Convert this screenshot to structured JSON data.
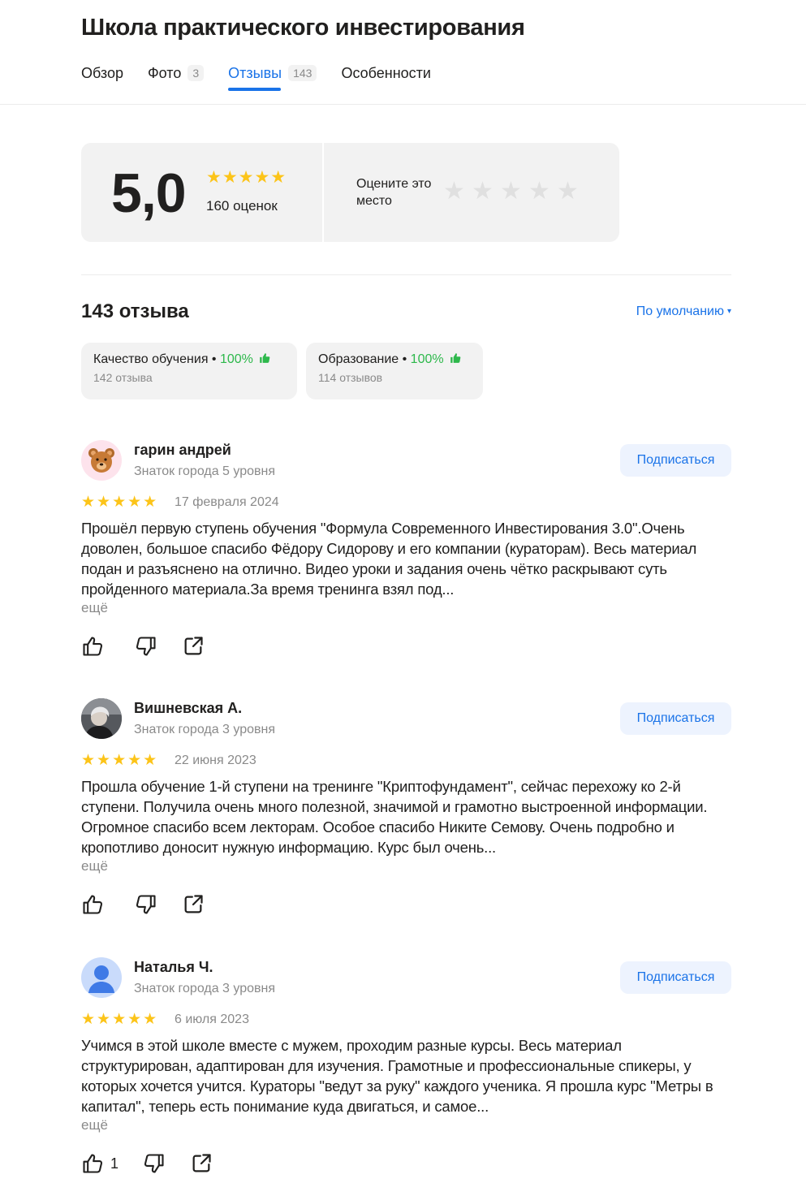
{
  "page": {
    "title": "Школа практического инвестирования"
  },
  "tabs": [
    {
      "label": "Обзор",
      "count": ""
    },
    {
      "label": "Фото",
      "count": "3"
    },
    {
      "label": "Отзывы",
      "count": "143"
    },
    {
      "label": "Особенности",
      "count": ""
    }
  ],
  "rating": {
    "value": "5,0",
    "stars": "★★★★★",
    "count_label": "160 оценок",
    "rate_prompt": "Оцените это место",
    "rate_stars": 5
  },
  "reviews_section": {
    "heading": "143 отзыва",
    "sort_label": "По умолчанию",
    "sort_arrow": "▾"
  },
  "aspects": [
    {
      "title": "Качество обучения",
      "sep": " • ",
      "percent": "100%",
      "count": "142 отзыва"
    },
    {
      "title": "Образование",
      "sep": " • ",
      "percent": "100%",
      "count": "114 отзывов"
    }
  ],
  "reviews": [
    {
      "author": "гарин андрей",
      "level": "Знаток города 5 уровня",
      "avatar": "bear-emoji-avatar",
      "stars": "★★★★★",
      "rating": 5,
      "date": "17 февраля 2024",
      "text": "Прошёл первую ступень обучения \"Формула Современного Инвестирования 3.0\".Очень доволен, большое спасибо Фёдору Сидорову и его компании (кураторам). Весь материал подан и разъяснено на отлично. Видео уроки и задания очень чётко раскрывают суть пройденного материала.За время тренинга взял под...",
      "more": "ещё",
      "subscribe": "Подписаться",
      "likes": ""
    },
    {
      "author": "Вишневская А.",
      "level": "Знаток города 3 уровня",
      "avatar": "photo-avatar",
      "stars": "★★★★★",
      "rating": 5,
      "date": "22 июня 2023",
      "text": "Прошла обучение 1-й ступени на тренинге \"Криптофундамент\", сейчас перехожу ко 2-й ступени. Получила очень много полезной, значимой и грамотно выстроенной информации. Огромное спасибо всем лекторам. Особое спасибо Никите Семову. Очень подробно и кропотливо доносит нужную информацию. Курс был очень...",
      "more": "ещё",
      "subscribe": "Подписаться",
      "likes": ""
    },
    {
      "author": "Наталья Ч.",
      "level": "Знаток города 3 уровня",
      "avatar": "default-user-avatar",
      "stars": "★★★★★",
      "rating": 5,
      "date": "6 июля 2023",
      "text": "Учимся в этой школе вместе с мужем, проходим разные курсы. Весь материал структурирован, адаптирован для изучения. Грамотные и профессиональные спикеры, у которых хочется учится. Кураторы \"ведут за руку\" каждого ученика. Я прошла курс \"Метры в капитал\", теперь есть понимание куда двигаться, и самое...",
      "more": "ещё",
      "subscribe": "Подписаться",
      "likes": "1"
    }
  ],
  "colors": {
    "accent": "#1a73e8",
    "star": "#fcc419",
    "positive": "#2db84b",
    "muted": "#8a8a8a",
    "card_bg": "#f2f2f2",
    "subscribe_bg": "#edf3fe"
  }
}
